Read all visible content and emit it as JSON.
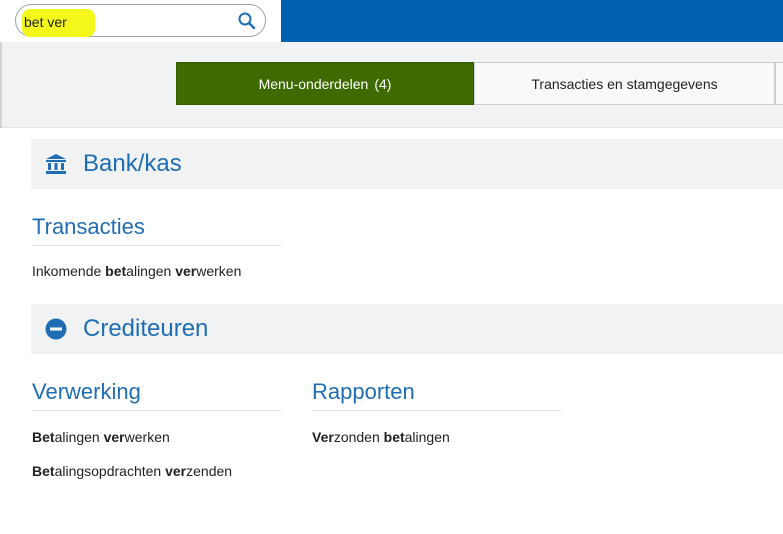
{
  "search": {
    "value": "bet ver"
  },
  "tabs": [
    {
      "label": "Menu-onderdelen",
      "count": "(4)"
    },
    {
      "label": "Transacties en stamgegevens"
    }
  ],
  "sections": [
    {
      "title": "Bank/kas",
      "icon": "bank-icon",
      "groups": [
        {
          "title": "Transacties",
          "items": [
            {
              "parts": [
                "Inkomende ",
                "bet",
                "alingen ",
                "ver",
                "werken"
              ]
            }
          ]
        }
      ]
    },
    {
      "title": "Crediteuren",
      "icon": "minus-circle-icon",
      "groups": [
        {
          "title": "Verwerking",
          "items": [
            {
              "parts": [
                "",
                "Bet",
                "alingen ",
                "ver",
                "werken"
              ]
            },
            {
              "parts": [
                "",
                "Bet",
                "alingsopdrachten ",
                "ver",
                "zenden"
              ]
            }
          ]
        },
        {
          "title": "Rapporten",
          "items": [
            {
              "parts": [
                "",
                "Ver",
                "zonden ",
                "bet",
                "alingen"
              ]
            }
          ]
        }
      ]
    }
  ],
  "colors": {
    "topbar": "#0060b0",
    "active_tab": "#3e6b00",
    "heading": "#1f6db3",
    "search_highlight": "#f4f81a"
  }
}
